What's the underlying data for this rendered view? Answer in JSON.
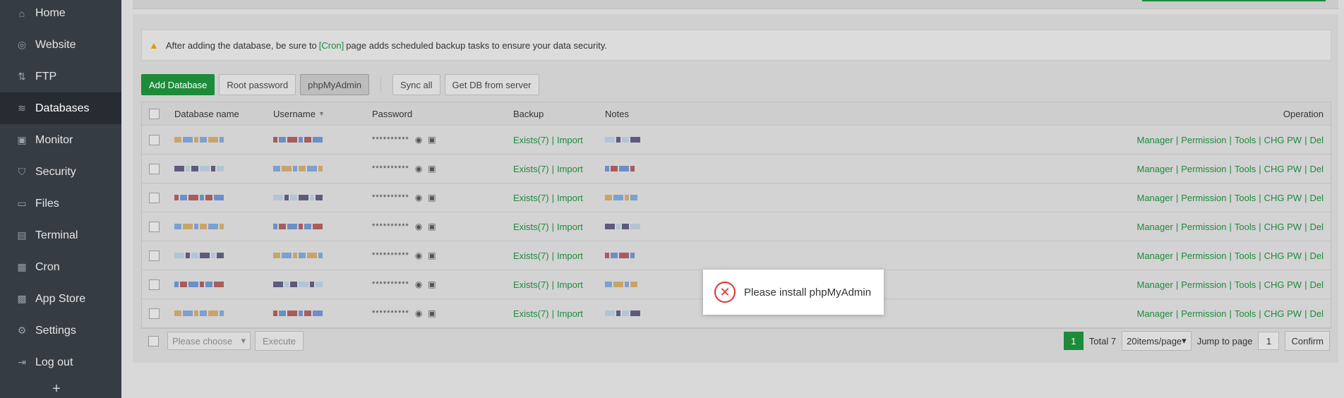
{
  "sidebar": {
    "items": [
      {
        "label": "Home",
        "icon": "home-icon",
        "glyph": "⌂"
      },
      {
        "label": "Website",
        "icon": "globe-icon",
        "glyph": "◎"
      },
      {
        "label": "FTP",
        "icon": "ftp-icon",
        "glyph": "⇅"
      },
      {
        "label": "Databases",
        "icon": "database-icon",
        "glyph": "≋"
      },
      {
        "label": "Monitor",
        "icon": "monitor-icon",
        "glyph": "▣"
      },
      {
        "label": "Security",
        "icon": "shield-icon",
        "glyph": "⛉"
      },
      {
        "label": "Files",
        "icon": "folder-icon",
        "glyph": "▭"
      },
      {
        "label": "Terminal",
        "icon": "terminal-icon",
        "glyph": "▤"
      },
      {
        "label": "Cron",
        "icon": "calendar-icon",
        "glyph": "▦"
      },
      {
        "label": "App Store",
        "icon": "apps-icon",
        "glyph": "▩"
      },
      {
        "label": "Settings",
        "icon": "gear-icon",
        "glyph": "⚙"
      },
      {
        "label": "Log out",
        "icon": "logout-icon",
        "glyph": "⇥"
      }
    ],
    "plus": "+"
  },
  "warning": {
    "before": "After adding the database, be sure to",
    "link": "[Cron]",
    "after": "page adds scheduled backup tasks to ensure your data security."
  },
  "toolbar": {
    "add": "Add Database",
    "root": "Root password",
    "pma": "phpMyAdmin",
    "sync": "Sync all",
    "getdb": "Get DB from server"
  },
  "table": {
    "headers": {
      "name": "Database name",
      "user": "Username",
      "pass": "Password",
      "backup": "Backup",
      "notes": "Notes",
      "op": "Operation"
    },
    "pass_mask": "**********",
    "backup_exists": "Exists(7)",
    "backup_import": "Import",
    "ops": [
      "Manager",
      "Permission",
      "Tools",
      "CHG PW",
      "Del"
    ],
    "row_count": 7
  },
  "footer": {
    "choose": "Please choose",
    "execute": "Execute",
    "page": "1",
    "total": "Total 7",
    "per_page": "20items/page",
    "jump": "Jump to page",
    "jump_value": "1",
    "confirm": "Confirm"
  },
  "toast": {
    "text": "Please install phpMyAdmin"
  },
  "colors": {
    "accent": "#1d8b3a",
    "sidebar": "#363c44",
    "error": "#e03131"
  }
}
